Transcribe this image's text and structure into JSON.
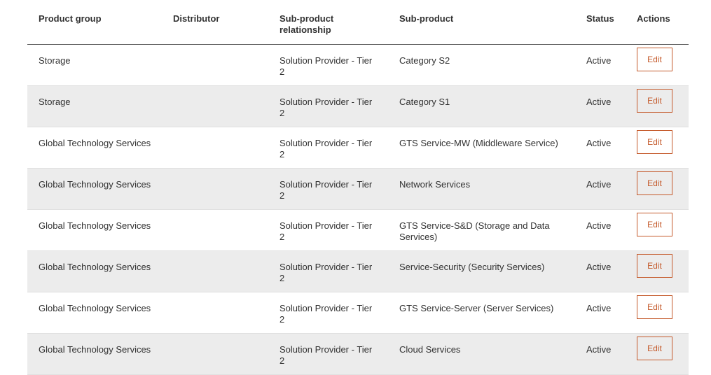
{
  "table": {
    "headers": {
      "product_group": "Product group",
      "distributor": "Distributor",
      "relationship": "Sub-product relationship",
      "sub_product": "Sub-product",
      "status": "Status",
      "actions": "Actions"
    },
    "rows": [
      {
        "product_group": "Storage",
        "distributor": "",
        "relationship": "Solution Provider - Tier 2",
        "sub_product": "Category S2",
        "status": "Active",
        "action": "Edit"
      },
      {
        "product_group": "Storage",
        "distributor": "",
        "relationship": "Solution Provider - Tier 2",
        "sub_product": "Category S1",
        "status": "Active",
        "action": "Edit"
      },
      {
        "product_group": "Global Technology Services",
        "distributor": "",
        "relationship": "Solution Provider - Tier 2",
        "sub_product": "GTS Service-MW (Middleware Service)",
        "status": "Active",
        "action": "Edit"
      },
      {
        "product_group": "Global Technology Services",
        "distributor": "",
        "relationship": "Solution Provider - Tier 2",
        "sub_product": "Network Services",
        "status": "Active",
        "action": "Edit"
      },
      {
        "product_group": "Global Technology Services",
        "distributor": "",
        "relationship": "Solution Provider - Tier 2",
        "sub_product": "GTS Service-S&D (Storage and Data Services)",
        "status": "Active",
        "action": "Edit"
      },
      {
        "product_group": "Global Technology Services",
        "distributor": "",
        "relationship": "Solution Provider - Tier 2",
        "sub_product": "Service-Security (Security Services)",
        "status": "Active",
        "action": "Edit"
      },
      {
        "product_group": "Global Technology Services",
        "distributor": "",
        "relationship": "Solution Provider - Tier 2",
        "sub_product": "GTS Service-Server (Server Services)",
        "status": "Active",
        "action": "Edit"
      },
      {
        "product_group": "Global Technology Services",
        "distributor": "",
        "relationship": "Solution Provider - Tier 2",
        "sub_product": "Cloud Services",
        "status": "Active",
        "action": "Edit"
      }
    ]
  },
  "colors": {
    "accent": "#c4592a",
    "row_alt": "#ececec"
  }
}
